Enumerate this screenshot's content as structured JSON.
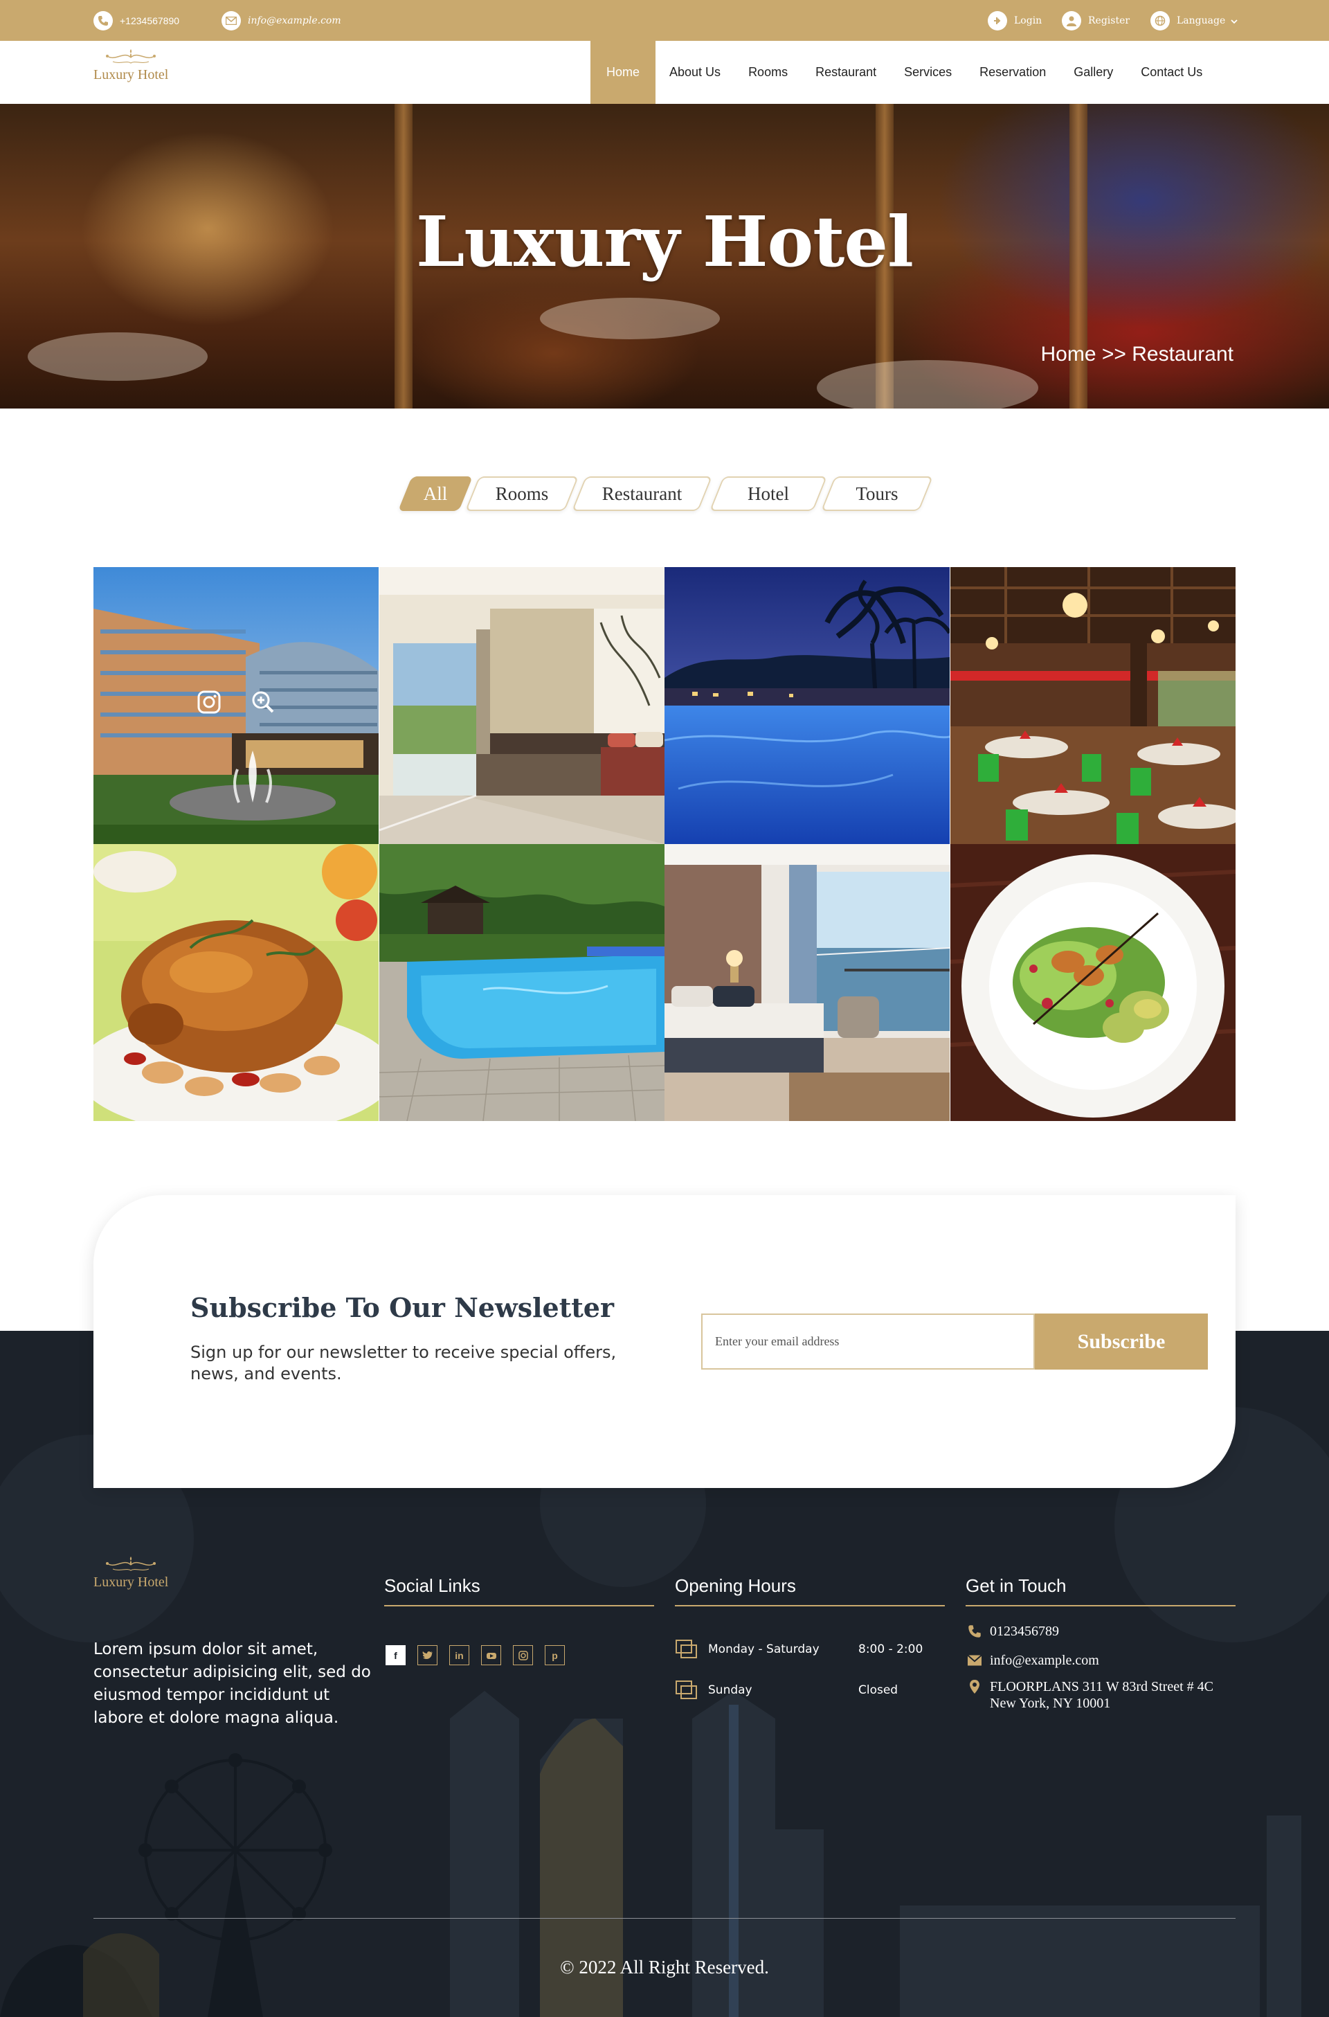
{
  "topbar": {
    "phone": "+1234567890",
    "email": "info@example.com",
    "login": "Login",
    "register": "Register",
    "language": "Language"
  },
  "brand": {
    "name": "Luxury Hotel"
  },
  "nav": {
    "items": [
      {
        "label": "Home",
        "active": true
      },
      {
        "label": "About Us"
      },
      {
        "label": "Rooms"
      },
      {
        "label": "Restaurant"
      },
      {
        "label": "Services"
      },
      {
        "label": "Reservation"
      },
      {
        "label": "Gallery"
      },
      {
        "label": "Contact Us"
      }
    ]
  },
  "hero": {
    "title": "Luxury Hotel",
    "breadcrumb": "Home >> Restaurant"
  },
  "filters": {
    "items": [
      {
        "label": "All",
        "active": true
      },
      {
        "label": "Rooms"
      },
      {
        "label": "Restaurant"
      },
      {
        "label": "Hotel"
      },
      {
        "label": "Tours"
      }
    ]
  },
  "gallery": {
    "items": [
      {
        "subject": "hotel-exterior-fountain"
      },
      {
        "subject": "hotel-room-balcony"
      },
      {
        "subject": "pool-night-palms"
      },
      {
        "subject": "restaurant-interior"
      },
      {
        "subject": "roast-chicken"
      },
      {
        "subject": "outdoor-pool"
      },
      {
        "subject": "seaview-room"
      },
      {
        "subject": "salad-plate"
      }
    ]
  },
  "newsletter": {
    "title": "Subscribe To Our Newsletter",
    "description": "Sign up for our newsletter to receive special offers, news, and events.",
    "placeholder": "Enter your email address",
    "button": "Subscribe"
  },
  "footer": {
    "about": "Lorem ipsum dolor sit amet, consectetur adipisicing elit, sed do eiusmod tempor incididunt ut labore et dolore magna aliqua.",
    "social_title": "Social Links",
    "social": [
      "facebook-icon",
      "twitter-icon",
      "linkedin-icon",
      "youtube-icon",
      "instagram-icon",
      "pinterest-icon"
    ],
    "hours_title": "Opening Hours",
    "hours": [
      {
        "day": "Monday  - Saturday",
        "time": "8:00 - 2:00"
      },
      {
        "day": "Sunday",
        "time": "Closed"
      }
    ],
    "contact_title": "Get in Touch",
    "phone": "0123456789",
    "email": "info@example.com",
    "address_line1": "FLOORPLANS 311 W 83rd Street # 4C",
    "address_line2": "New York, NY 10001",
    "copyright": "© 2022 All Right Reserved."
  },
  "colors": {
    "accent": "#c9a96e",
    "dark": "#1c222a",
    "title": "#2e3a48"
  }
}
